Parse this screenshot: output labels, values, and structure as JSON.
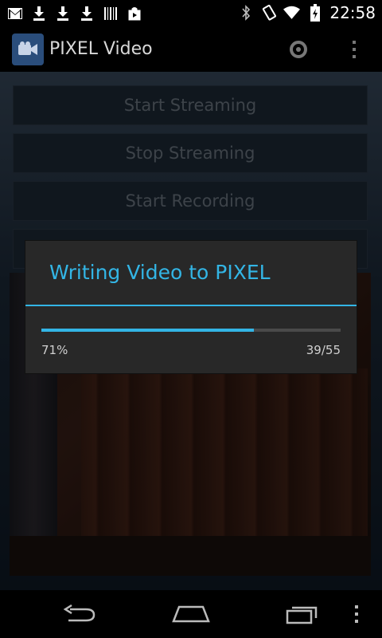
{
  "status_bar": {
    "time": "22:58",
    "notification_icons": [
      "gmail-icon",
      "download-icon",
      "download-icon",
      "download-icon",
      "barcode-icon",
      "play-store-icon"
    ],
    "system_icons": [
      "bluetooth-icon",
      "vibrate-icon",
      "wifi-icon",
      "battery-icon"
    ]
  },
  "action_bar": {
    "title": "PIXEL Video",
    "app_icon": "video-camera-icon",
    "actions": [
      "settings-icon",
      "overflow-menu-icon"
    ]
  },
  "buttons": [
    {
      "label": "Start Streaming"
    },
    {
      "label": "Stop Streaming"
    },
    {
      "label": "Start Recording"
    }
  ],
  "dialog": {
    "title": "Writing Video to PIXEL",
    "progress_percent_label": "71%",
    "progress_count": "39/55",
    "progress_fraction": 0.71
  },
  "nav_bar": {
    "buttons": [
      "back-icon",
      "home-icon",
      "recent-apps-icon",
      "overflow-menu-icon"
    ]
  },
  "colors": {
    "accent": "#33b5e5",
    "dialog_bg": "#282828"
  }
}
